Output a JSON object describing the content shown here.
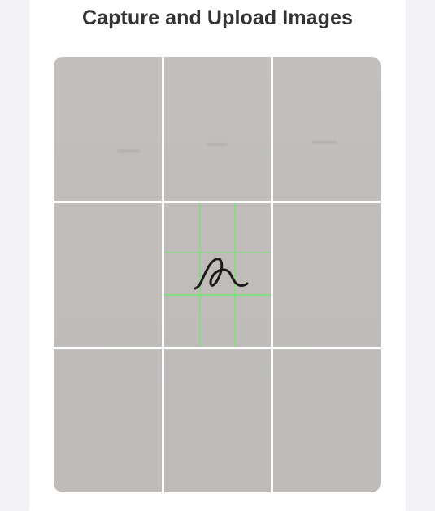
{
  "header": {
    "title": "Capture and Upload Images"
  },
  "camera": {
    "grid": "3x3",
    "captured_glyph": "a",
    "focus_color": "#7ee07a",
    "grid_color": "#ffffff"
  }
}
